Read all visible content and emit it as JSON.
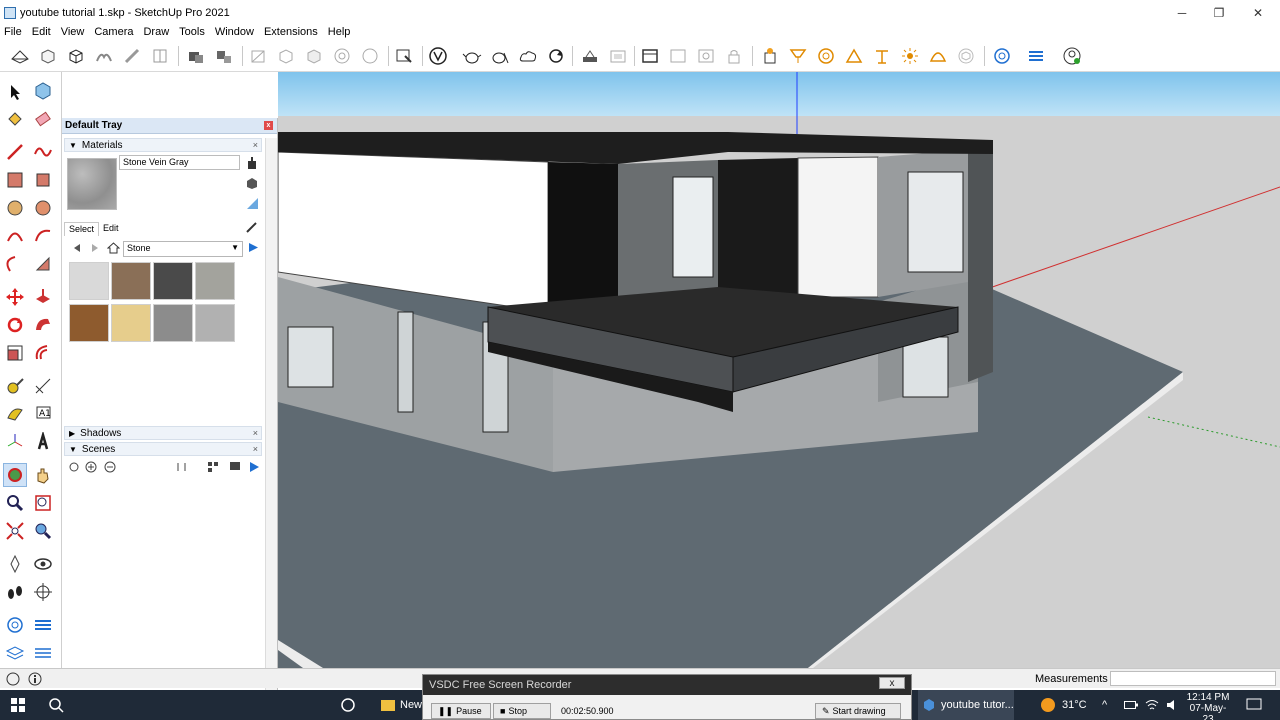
{
  "window": {
    "title": "youtube tutorial 1.skp - SketchUp Pro 2021",
    "minimize": "─",
    "maximize": "❐",
    "close": "✕"
  },
  "menu": [
    "File",
    "Edit",
    "View",
    "Camera",
    "Draw",
    "Tools",
    "Window",
    "Extensions",
    "Help"
  ],
  "tray": {
    "title": "Default Tray",
    "close": "x",
    "materials": {
      "header": "Materials",
      "current_name": "Stone Vein Gray",
      "tab_select": "Select",
      "tab_edit": "Edit",
      "library": "Stone",
      "swatches": [
        "#d9d9d9",
        "#8a6f57",
        "#4a4a4a",
        "#a3a39d",
        "#8e5b2e",
        "#e6cd8c",
        "#8c8c8c",
        "#b1b1b1"
      ]
    },
    "shadows": {
      "header": "Shadows"
    },
    "scenes": {
      "header": "Scenes"
    }
  },
  "status": {
    "measurements_label": "Measurements",
    "measurements_value": ""
  },
  "recorder": {
    "title": "VSDC Free Screen Recorder",
    "close": "x",
    "pause": "Pause",
    "stop": "Stop",
    "time": "00:02:50.900",
    "start": "Start drawing"
  },
  "taskbar": {
    "folder_label": "New",
    "app_label": "youtube tutor...",
    "temperature": "31°C",
    "time": "12:14 PM",
    "date": "07-May-23"
  },
  "colors": {
    "sky_top": "#7fc3ec",
    "ground": "#d0d0d0",
    "slab": "#5f6a72",
    "accent_blue": "#1f6fd1"
  }
}
